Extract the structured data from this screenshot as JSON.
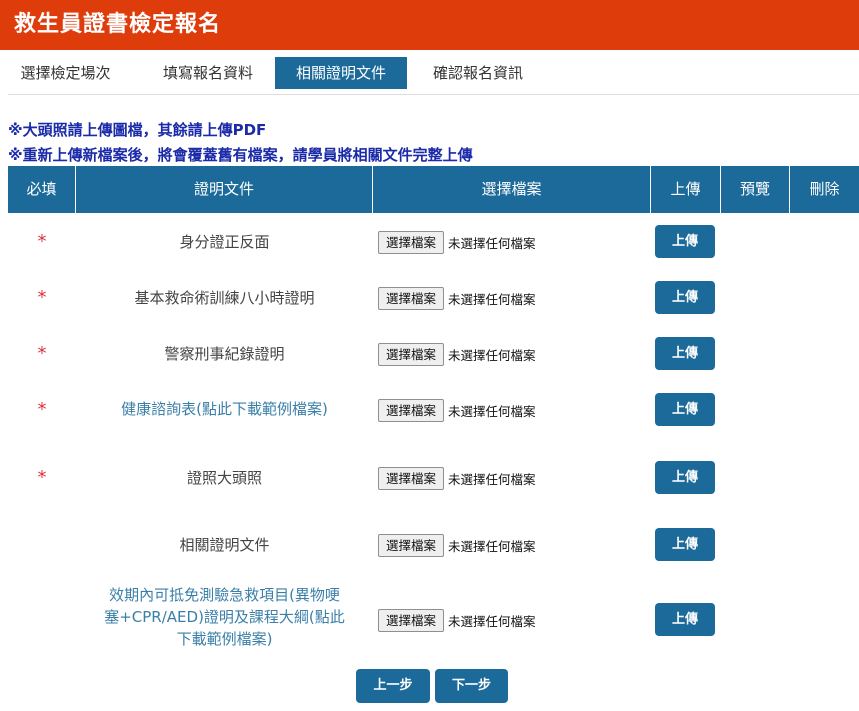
{
  "header": {
    "title": "救生員證書檢定報名"
  },
  "tabs": [
    {
      "label": "選擇檢定場次"
    },
    {
      "label": "填寫報名資料"
    },
    {
      "label": "相關證明文件"
    },
    {
      "label": "確認報名資訊"
    }
  ],
  "notices": [
    "※大頭照請上傳圖檔，其餘請上傳PDF",
    "※重新上傳新檔案後，將會覆蓋舊有檔案，請學員將相關文件完整上傳"
  ],
  "table": {
    "headers": [
      "必填",
      "證明文件",
      "選擇檔案",
      "上傳",
      "預覽",
      "刪除"
    ],
    "rows": [
      {
        "required_mark": "*",
        "document": "身分證正反面",
        "file_button": "選擇檔案",
        "file_status": "未選擇任何檔案",
        "upload_label": "上傳"
      },
      {
        "required_mark": "*",
        "document": "基本救命術訓練八小時證明",
        "file_button": "選擇檔案",
        "file_status": "未選擇任何檔案",
        "upload_label": "上傳"
      },
      {
        "required_mark": "*",
        "document": "警察刑事紀錄證明",
        "file_button": "選擇檔案",
        "file_status": "未選擇任何檔案",
        "upload_label": "上傳"
      },
      {
        "required_mark": "*",
        "document": "健康諮詢表(點此下載範例檔案)",
        "file_button": "選擇檔案",
        "file_status": "未選擇任何檔案",
        "upload_label": "上傳"
      },
      {
        "required_mark": "*",
        "document": "證照大頭照",
        "file_button": "選擇檔案",
        "file_status": "未選擇任何檔案",
        "upload_label": "上傳"
      },
      {
        "required_mark": "",
        "document": "相關證明文件",
        "file_button": "選擇檔案",
        "file_status": "未選擇任何檔案",
        "upload_label": "上傳"
      },
      {
        "required_mark": "",
        "document_lines": [
          "效期內可抵免測驗急救項目(異物哽",
          "塞+CPR/AED)證明及課程大綱(點此",
          "下載範例檔案)"
        ],
        "file_button": "選擇檔案",
        "file_status": "未選擇任何檔案",
        "upload_label": "上傳"
      }
    ]
  },
  "buttons": {
    "prev": "上一步",
    "next": "下一步"
  },
  "colors": {
    "header_bg": "#df3c0c",
    "primary": "#1b6a9a",
    "notice_text": "#1a2aa8",
    "required_mark": "#d9333a",
    "link_text": "#3a7fa8"
  }
}
